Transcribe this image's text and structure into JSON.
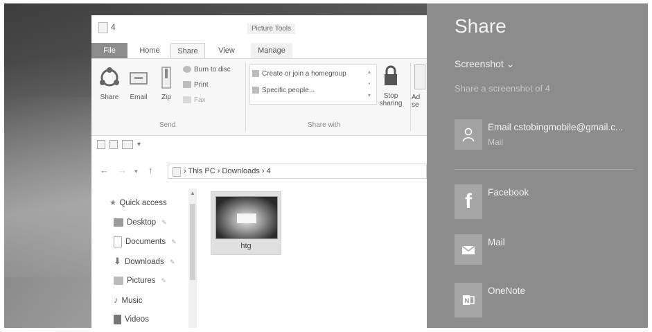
{
  "explorer": {
    "title": "4",
    "picture_tools": "Picture Tools",
    "tabs": [
      "File",
      "Home",
      "Share",
      "View",
      "Manage"
    ],
    "ribbon": {
      "share": "Share",
      "email": "Email",
      "zip": "Zip",
      "burn": "Burn to disc",
      "print": "Print",
      "fax": "Fax",
      "send_group": "Send",
      "homegroup": "Create or join a homegroup",
      "specific": "Specific people...",
      "stop_sharing_1": "Stop",
      "stop_sharing_2": "sharing",
      "partial_1": "Ad",
      "partial_2": "se",
      "share_with_group": "Share with"
    },
    "qat_arrow": "▾",
    "address": {
      "path": "›  This PC  ›  Downloads  ›  4"
    },
    "nav": [
      {
        "label": "Quick access"
      },
      {
        "label": "Desktop"
      },
      {
        "label": "Documents"
      },
      {
        "label": "Downloads"
      },
      {
        "label": "Pictures"
      },
      {
        "label": "Music"
      },
      {
        "label": "Videos"
      }
    ],
    "file": {
      "name": "htg"
    }
  },
  "share": {
    "title": "Share",
    "dropdown": "Screenshot ⌄",
    "description": "Share a screenshot of 4",
    "targets": [
      {
        "name": "Email cstobingmobile@gmail.c...",
        "sub": "Mail",
        "icon": "person-icon"
      },
      {
        "name": "Facebook",
        "icon": "facebook-icon"
      },
      {
        "name": "Mail",
        "icon": "mail-icon"
      },
      {
        "name": "OneNote",
        "icon": "onenote-icon"
      }
    ]
  }
}
